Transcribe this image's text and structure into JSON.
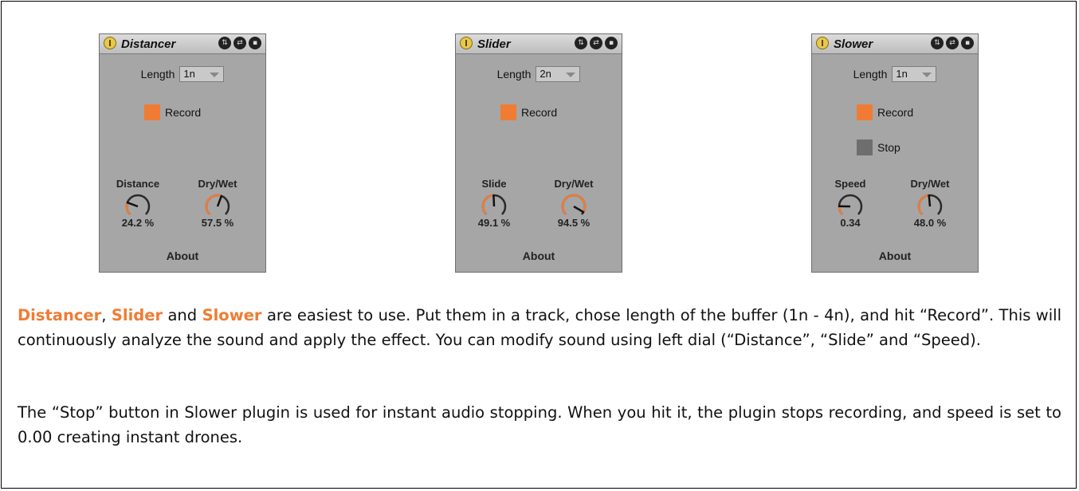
{
  "devices": [
    {
      "title": "Distancer",
      "length_label": "Length",
      "length_value": "1n",
      "record_label": "Record",
      "dials": [
        {
          "label": "Distance",
          "value_text": "24.2 %",
          "fraction": 0.242
        },
        {
          "label": "Dry/Wet",
          "value_text": "57.5 %",
          "fraction": 0.575
        }
      ],
      "about_label": "About"
    },
    {
      "title": "Slider",
      "length_label": "Length",
      "length_value": "2n",
      "record_label": "Record",
      "dials": [
        {
          "label": "Slide",
          "value_text": "49.1 %",
          "fraction": 0.491
        },
        {
          "label": "Dry/Wet",
          "value_text": "94.5 %",
          "fraction": 0.945
        }
      ],
      "about_label": "About"
    },
    {
      "title": "Slower",
      "length_label": "Length",
      "length_value": "1n",
      "record_label": "Record",
      "stop_label": "Stop",
      "dials": [
        {
          "label": "Speed",
          "value_text": "0.34",
          "fraction": 0.17
        },
        {
          "label": "Dry/Wet",
          "value_text": "48.0 %",
          "fraction": 0.48
        }
      ],
      "about_label": "About"
    }
  ],
  "paragraph1": {
    "name1": "Distancer",
    "sep1": ", ",
    "name2": "Slider",
    "sep2": " and ",
    "name3": "Slower",
    "rest": " are easiest to use. Put them in a track, chose length of the buffer (1n - 4n), and hit “Record”. This will continuously analyze the sound and apply the effect. You can modify sound using left dial (“Distance”, “Slide” and “Speed)."
  },
  "paragraph2": "The “Stop” button in Slower plugin is used for instant audio stopping. When you hit it, the plugin stops recording, and speed is set to 0.00 creating instant drones.",
  "colors": {
    "accent": "#f07c33",
    "device_bg": "#a6a6a6",
    "dial_track": "#2a2a2a"
  },
  "icons": [
    "power-icon",
    "hot-swap-icon",
    "unfold-icon",
    "save-icon"
  ]
}
